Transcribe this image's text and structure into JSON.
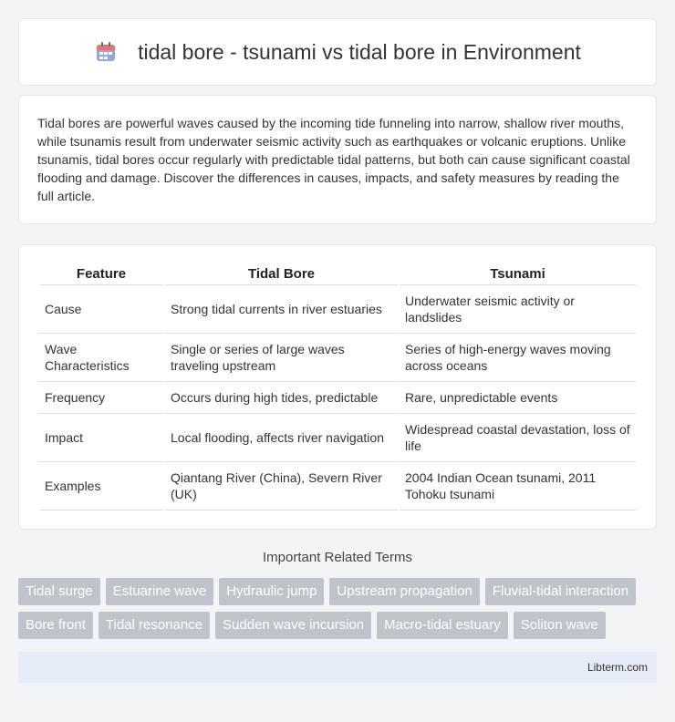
{
  "header": {
    "title": "tidal bore - tsunami vs tidal bore in Environment",
    "icon": "calendar-icon"
  },
  "intro": {
    "text": "Tidal bores are powerful waves caused by the incoming tide funneling into narrow, shallow river mouths, while tsunamis result from underwater seismic activity such as earthquakes or volcanic eruptions. Unlike tsunamis, tidal bores occur regularly with predictable tidal patterns, but both can cause significant coastal flooding and damage. Discover the differences in causes, impacts, and safety measures by reading the full article."
  },
  "table": {
    "headers": [
      "Feature",
      "Tidal Bore",
      "Tsunami"
    ],
    "rows": [
      [
        "Cause",
        "Strong tidal currents in river estuaries",
        "Underwater seismic activity or landslides"
      ],
      [
        "Wave Characteristics",
        "Single or series of large waves traveling upstream",
        "Series of high-energy waves moving across oceans"
      ],
      [
        "Frequency",
        "Occurs during high tides, predictable",
        "Rare, unpredictable events"
      ],
      [
        "Impact",
        "Local flooding, affects river navigation",
        "Widespread coastal devastation, loss of life"
      ],
      [
        "Examples",
        "Qiantang River (China), Severn River (UK)",
        "2004 Indian Ocean tsunami, 2011 Tohoku tsunami"
      ]
    ]
  },
  "related": {
    "title": "Important Related Terms",
    "tags": [
      "Tidal surge",
      "Estuarine wave",
      "Hydraulic jump",
      "Upstream propagation",
      "Fluvial-tidal interaction",
      "Bore front",
      "Tidal resonance",
      "Sudden wave incursion",
      "Macro-tidal estuary",
      "Soliton wave"
    ]
  },
  "footer": {
    "text": "Libterm.com"
  }
}
